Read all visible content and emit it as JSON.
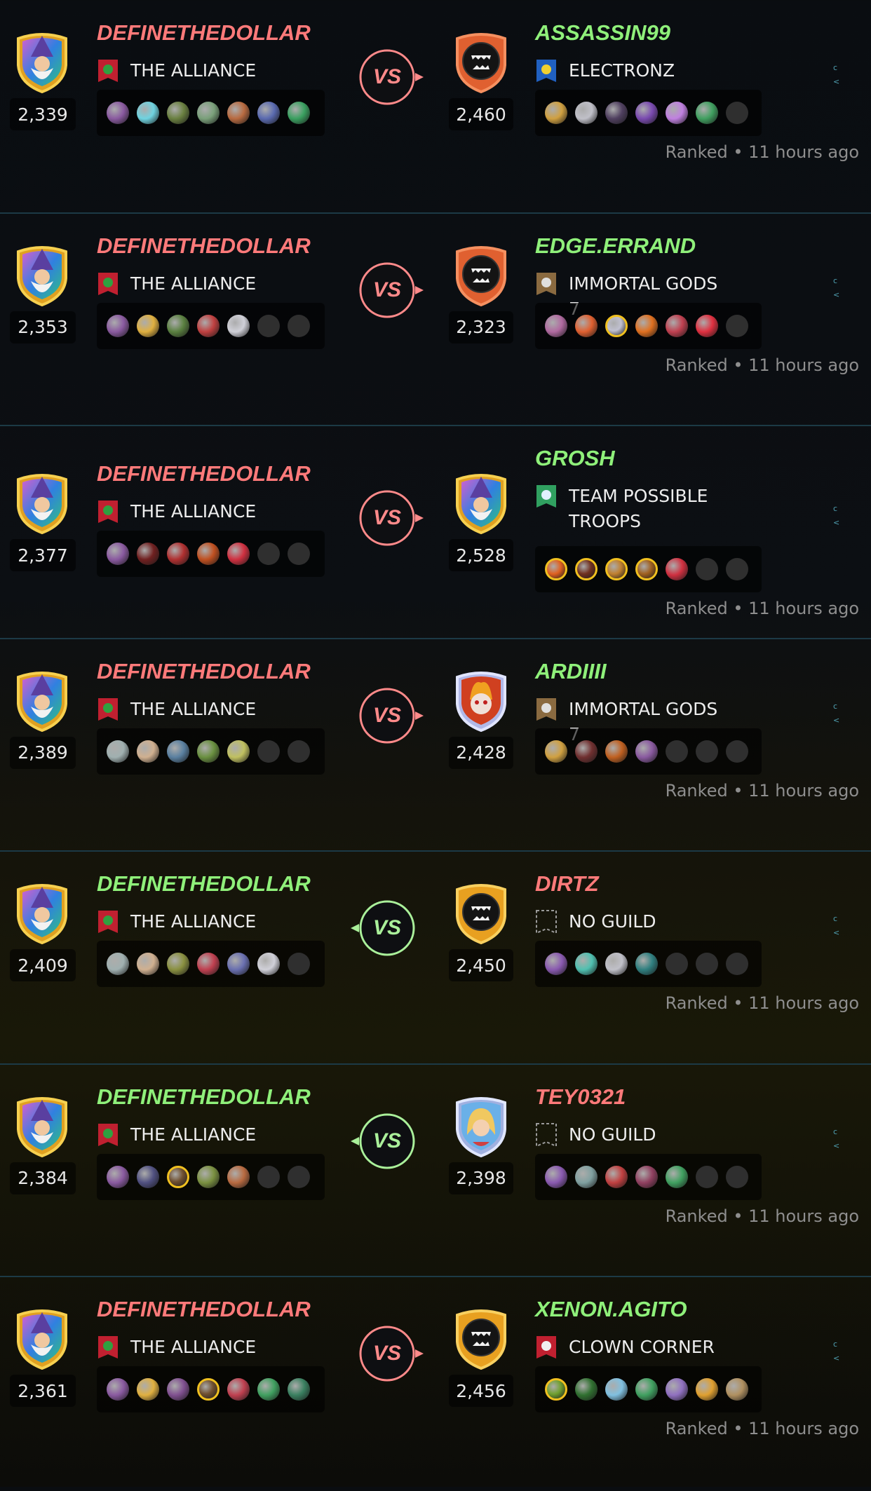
{
  "battles": [
    {
      "player": {
        "name": "DEFINETHEDOLLAR",
        "color": "#ff7a7a",
        "rating": "2,339",
        "guild": "THE ALLIANCE",
        "guild_icon": "alliance-flag-icon",
        "team": [
          "#8a5aa0",
          "#6fd3e0",
          "#6a8040",
          "#7aa07a",
          "#b86a40",
          "#5a6ab0",
          "#3aa060"
        ]
      },
      "result_color": "#ff8a8a",
      "result_label": "VS",
      "arrow": "right",
      "opponent": {
        "name": "ASSASSIN99",
        "color": "#8ff07a",
        "rating": "2,460",
        "guild": "ELECTRONZ",
        "guild_icon": "lightning-flag-icon",
        "avatar": "orange-monster",
        "team": [
          "#d0a040",
          "#c0c0c8",
          "#504060",
          "#7a4ab0",
          "#c080e0",
          "#40a060",
          "empty"
        ]
      },
      "status": "Ranked • 11 hours ago"
    },
    {
      "player": {
        "name": "DEFINETHEDOLLAR",
        "color": "#ff7a7a",
        "rating": "2,353",
        "guild": "THE ALLIANCE",
        "guild_icon": "alliance-flag-icon",
        "team": [
          "#8a5aa0",
          "#e0b040",
          "#5a8040",
          "#c04040",
          "#d0d0d8",
          "empty",
          "empty"
        ]
      },
      "result_color": "#ff8a8a",
      "result_label": "VS",
      "arrow": "right",
      "opponent": {
        "name": "EDGE.ERRAND",
        "color": "#8ff07a",
        "rating": "2,323",
        "guild": "IMMORTAL GODS 7",
        "guild_icon": "sword-flag-icon",
        "avatar": "orange-monster",
        "team": [
          "#b06aa0",
          "#e06030",
          "gold:#c0c0d0",
          "#e07020",
          "#c04050",
          "#e03040",
          "empty"
        ]
      },
      "status": "Ranked • 11 hours ago"
    },
    {
      "player": {
        "name": "DEFINETHEDOLLAR",
        "color": "#ff7a7a",
        "rating": "2,377",
        "guild": "THE ALLIANCE",
        "guild_icon": "alliance-flag-icon",
        "team": [
          "#8a5aa0",
          "#702020",
          "#b03030",
          "#c05020",
          "#d03040",
          "empty",
          "empty"
        ]
      },
      "result_color": "#ff8a8a",
      "result_label": "VS",
      "arrow": "right",
      "opponent": {
        "name": "GROSH",
        "color": "#8ff07a",
        "rating": "2,528",
        "guild": "TEAM POSSIBLE TROOPS",
        "guild_icon": "shield-flag-icon",
        "avatar": "wizard",
        "team": [
          "gold:#e06020",
          "gold:#703020",
          "gold:#c08030",
          "gold:#a06020",
          "#d03040",
          "empty",
          "empty"
        ]
      },
      "status": "Ranked • 11 hours ago"
    },
    {
      "player": {
        "name": "DEFINETHEDOLLAR",
        "color": "#ff7a7a",
        "rating": "2,389",
        "guild": "THE ALLIANCE",
        "guild_icon": "alliance-flag-icon",
        "team": [
          "#a0b0b0",
          "#d0b090",
          "#5a80a0",
          "#6a9040",
          "#c0c060",
          "empty",
          "empty"
        ]
      },
      "result_color": "#ff8a8a",
      "result_label": "VS",
      "arrow": "right",
      "opponent": {
        "name": "ARDIIII",
        "color": "#8ff07a",
        "rating": "2,428",
        "guild": "IMMORTAL GODS 7",
        "guild_icon": "sword-flag-icon",
        "avatar": "fire-skull",
        "team": [
          "#d0a040",
          "#703030",
          "#c06020",
          "#8a5aa0",
          "empty",
          "empty",
          "empty"
        ]
      },
      "status": "Ranked • 11 hours ago"
    },
    {
      "player": {
        "name": "DEFINETHEDOLLAR",
        "color": "#8ff07a",
        "rating": "2,409",
        "guild": "THE ALLIANCE",
        "guild_icon": "alliance-flag-icon",
        "team": [
          "#a0b0b0",
          "#d0b090",
          "#8a9040",
          "#c04050",
          "#6a70b0",
          "#d0d0d8",
          "empty"
        ]
      },
      "result_color": "#aaf09a",
      "result_label": "VS",
      "arrow": "left",
      "opponent": {
        "name": "DIRTZ",
        "color": "#ff7a7a",
        "rating": "2,450",
        "guild": "NO GUILD",
        "guild_icon": "empty-flag-icon",
        "avatar": "gold-monster",
        "team": [
          "#8a5ab0",
          "#50c0b0",
          "#c0c0c8",
          "#308080",
          "empty",
          "empty",
          "empty"
        ]
      },
      "status": "Ranked • 11 hours ago"
    },
    {
      "player": {
        "name": "DEFINETHEDOLLAR",
        "color": "#8ff07a",
        "rating": "2,384",
        "guild": "THE ALLIANCE",
        "guild_icon": "alliance-flag-icon",
        "team": [
          "#8a5aa0",
          "#505080",
          "gold:#705030",
          "#7a9040",
          "#b86a40",
          "empty",
          "empty"
        ]
      },
      "result_color": "#aaf09a",
      "result_label": "VS",
      "arrow": "left",
      "opponent": {
        "name": "TEY0321",
        "color": "#ff7a7a",
        "rating": "2,398",
        "guild": "NO GUILD",
        "guild_icon": "empty-flag-icon",
        "avatar": "blonde-hero",
        "team": [
          "#8a5ab0",
          "#80a0a0",
          "#c04040",
          "#904060",
          "#40a060",
          "empty",
          "empty"
        ]
      },
      "status": "Ranked • 11 hours ago"
    },
    {
      "player": {
        "name": "DEFINETHEDOLLAR",
        "color": "#ff7a7a",
        "rating": "2,361",
        "guild": "THE ALLIANCE",
        "guild_icon": "alliance-flag-icon",
        "team": [
          "#8a5aa0",
          "#e0b040",
          "#805090",
          "gold:#705030",
          "#c04050",
          "#40a060",
          "#3a8060"
        ]
      },
      "result_color": "#ff8a8a",
      "result_label": "VS",
      "arrow": "right",
      "opponent": {
        "name": "XENON.AGITO",
        "color": "#8ff07a",
        "rating": "2,456",
        "guild": "CLOWN CORNER",
        "guild_icon": "clown-flag-icon",
        "avatar": "gold-monster",
        "team": [
          "gold:#70a030",
          "#307030",
          "#80c0e0",
          "#40a060",
          "#9070c0",
          "#e0a030",
          "#b09060"
        ]
      },
      "status": "Ranked • 11 hours ago"
    }
  ]
}
